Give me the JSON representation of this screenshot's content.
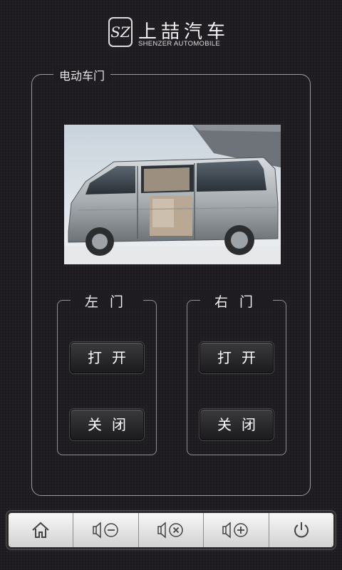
{
  "brand": {
    "logo_mark": "SZ",
    "name_cn": "上喆汽车",
    "name_en": "SHENZER AUTOMOBILE"
  },
  "panel": {
    "title": "电动车门"
  },
  "left_door": {
    "title": "左门",
    "open_label": "打开",
    "close_label": "关闭"
  },
  "right_door": {
    "title": "右门",
    "open_label": "打开",
    "close_label": "关闭"
  },
  "bottom_bar": {
    "icons": [
      "home-icon",
      "volume-down-icon",
      "volume-mute-icon",
      "volume-up-icon",
      "power-icon"
    ]
  }
}
